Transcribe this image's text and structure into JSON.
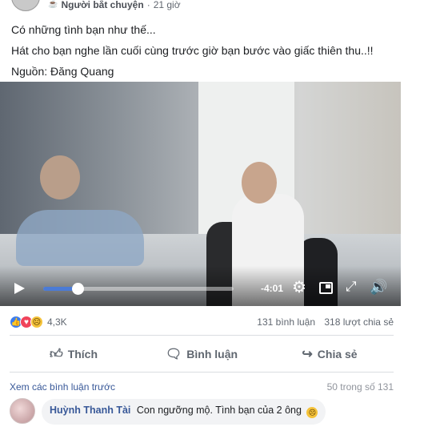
{
  "post": {
    "author_badge": "Người bắt chuyện",
    "time": "21 giờ",
    "lines": [
      "Có những tình bạn như thế...",
      "Hát cho bạn nghe lần cuối cùng trước giờ bạn bước vào giấc thiên thu..!!",
      "Nguồn: Đăng Quang"
    ]
  },
  "video": {
    "progress_fraction": 0.18,
    "time_remaining": "-4:01"
  },
  "stats": {
    "reaction_count": "4,3K",
    "comments": "131 bình luận",
    "shares": "318 lượt chia sẻ"
  },
  "actions": {
    "like": "Thích",
    "comment": "Bình luận",
    "share": "Chia sẻ"
  },
  "comments": {
    "view_previous": "Xem các bình luận trước",
    "pager": "50 trong số 131",
    "items": [
      {
        "author": "Huỳnh Thanh Tài",
        "text": "Con ngưỡng mộ. Tình bạn của 2 ông"
      }
    ]
  },
  "colors": {
    "link": "#385898",
    "progress": "#4b7bd6",
    "like": "#3b7df0",
    "love": "#f0445b",
    "sad": "#f5c33b"
  },
  "icons": [
    "play-icon",
    "gear-icon",
    "pip-icon",
    "fullscreen-icon",
    "volume-icon",
    "like-icon",
    "comment-icon",
    "share-icon"
  ]
}
